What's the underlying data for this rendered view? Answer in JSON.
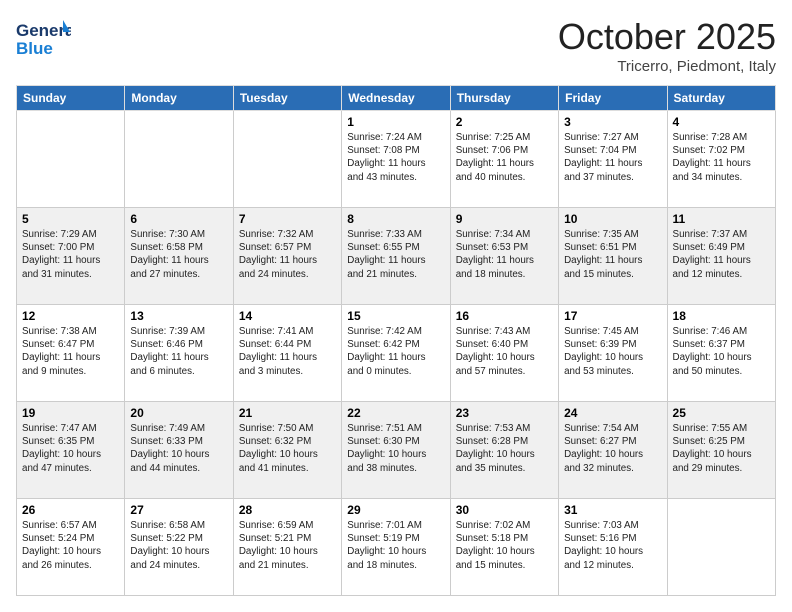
{
  "header": {
    "logo_general": "General",
    "logo_blue": "Blue",
    "month_title": "October 2025",
    "location": "Tricerro, Piedmont, Italy"
  },
  "calendar": {
    "days_of_week": [
      "Sunday",
      "Monday",
      "Tuesday",
      "Wednesday",
      "Thursday",
      "Friday",
      "Saturday"
    ],
    "weeks": [
      [
        {
          "day": "",
          "info": ""
        },
        {
          "day": "",
          "info": ""
        },
        {
          "day": "",
          "info": ""
        },
        {
          "day": "1",
          "info": "Sunrise: 7:24 AM\nSunset: 7:08 PM\nDaylight: 11 hours\nand 43 minutes."
        },
        {
          "day": "2",
          "info": "Sunrise: 7:25 AM\nSunset: 7:06 PM\nDaylight: 11 hours\nand 40 minutes."
        },
        {
          "day": "3",
          "info": "Sunrise: 7:27 AM\nSunset: 7:04 PM\nDaylight: 11 hours\nand 37 minutes."
        },
        {
          "day": "4",
          "info": "Sunrise: 7:28 AM\nSunset: 7:02 PM\nDaylight: 11 hours\nand 34 minutes."
        }
      ],
      [
        {
          "day": "5",
          "info": "Sunrise: 7:29 AM\nSunset: 7:00 PM\nDaylight: 11 hours\nand 31 minutes."
        },
        {
          "day": "6",
          "info": "Sunrise: 7:30 AM\nSunset: 6:58 PM\nDaylight: 11 hours\nand 27 minutes."
        },
        {
          "day": "7",
          "info": "Sunrise: 7:32 AM\nSunset: 6:57 PM\nDaylight: 11 hours\nand 24 minutes."
        },
        {
          "day": "8",
          "info": "Sunrise: 7:33 AM\nSunset: 6:55 PM\nDaylight: 11 hours\nand 21 minutes."
        },
        {
          "day": "9",
          "info": "Sunrise: 7:34 AM\nSunset: 6:53 PM\nDaylight: 11 hours\nand 18 minutes."
        },
        {
          "day": "10",
          "info": "Sunrise: 7:35 AM\nSunset: 6:51 PM\nDaylight: 11 hours\nand 15 minutes."
        },
        {
          "day": "11",
          "info": "Sunrise: 7:37 AM\nSunset: 6:49 PM\nDaylight: 11 hours\nand 12 minutes."
        }
      ],
      [
        {
          "day": "12",
          "info": "Sunrise: 7:38 AM\nSunset: 6:47 PM\nDaylight: 11 hours\nand 9 minutes."
        },
        {
          "day": "13",
          "info": "Sunrise: 7:39 AM\nSunset: 6:46 PM\nDaylight: 11 hours\nand 6 minutes."
        },
        {
          "day": "14",
          "info": "Sunrise: 7:41 AM\nSunset: 6:44 PM\nDaylight: 11 hours\nand 3 minutes."
        },
        {
          "day": "15",
          "info": "Sunrise: 7:42 AM\nSunset: 6:42 PM\nDaylight: 11 hours\nand 0 minutes."
        },
        {
          "day": "16",
          "info": "Sunrise: 7:43 AM\nSunset: 6:40 PM\nDaylight: 10 hours\nand 57 minutes."
        },
        {
          "day": "17",
          "info": "Sunrise: 7:45 AM\nSunset: 6:39 PM\nDaylight: 10 hours\nand 53 minutes."
        },
        {
          "day": "18",
          "info": "Sunrise: 7:46 AM\nSunset: 6:37 PM\nDaylight: 10 hours\nand 50 minutes."
        }
      ],
      [
        {
          "day": "19",
          "info": "Sunrise: 7:47 AM\nSunset: 6:35 PM\nDaylight: 10 hours\nand 47 minutes."
        },
        {
          "day": "20",
          "info": "Sunrise: 7:49 AM\nSunset: 6:33 PM\nDaylight: 10 hours\nand 44 minutes."
        },
        {
          "day": "21",
          "info": "Sunrise: 7:50 AM\nSunset: 6:32 PM\nDaylight: 10 hours\nand 41 minutes."
        },
        {
          "day": "22",
          "info": "Sunrise: 7:51 AM\nSunset: 6:30 PM\nDaylight: 10 hours\nand 38 minutes."
        },
        {
          "day": "23",
          "info": "Sunrise: 7:53 AM\nSunset: 6:28 PM\nDaylight: 10 hours\nand 35 minutes."
        },
        {
          "day": "24",
          "info": "Sunrise: 7:54 AM\nSunset: 6:27 PM\nDaylight: 10 hours\nand 32 minutes."
        },
        {
          "day": "25",
          "info": "Sunrise: 7:55 AM\nSunset: 6:25 PM\nDaylight: 10 hours\nand 29 minutes."
        }
      ],
      [
        {
          "day": "26",
          "info": "Sunrise: 6:57 AM\nSunset: 5:24 PM\nDaylight: 10 hours\nand 26 minutes."
        },
        {
          "day": "27",
          "info": "Sunrise: 6:58 AM\nSunset: 5:22 PM\nDaylight: 10 hours\nand 24 minutes."
        },
        {
          "day": "28",
          "info": "Sunrise: 6:59 AM\nSunset: 5:21 PM\nDaylight: 10 hours\nand 21 minutes."
        },
        {
          "day": "29",
          "info": "Sunrise: 7:01 AM\nSunset: 5:19 PM\nDaylight: 10 hours\nand 18 minutes."
        },
        {
          "day": "30",
          "info": "Sunrise: 7:02 AM\nSunset: 5:18 PM\nDaylight: 10 hours\nand 15 minutes."
        },
        {
          "day": "31",
          "info": "Sunrise: 7:03 AM\nSunset: 5:16 PM\nDaylight: 10 hours\nand 12 minutes."
        },
        {
          "day": "",
          "info": ""
        }
      ]
    ]
  }
}
